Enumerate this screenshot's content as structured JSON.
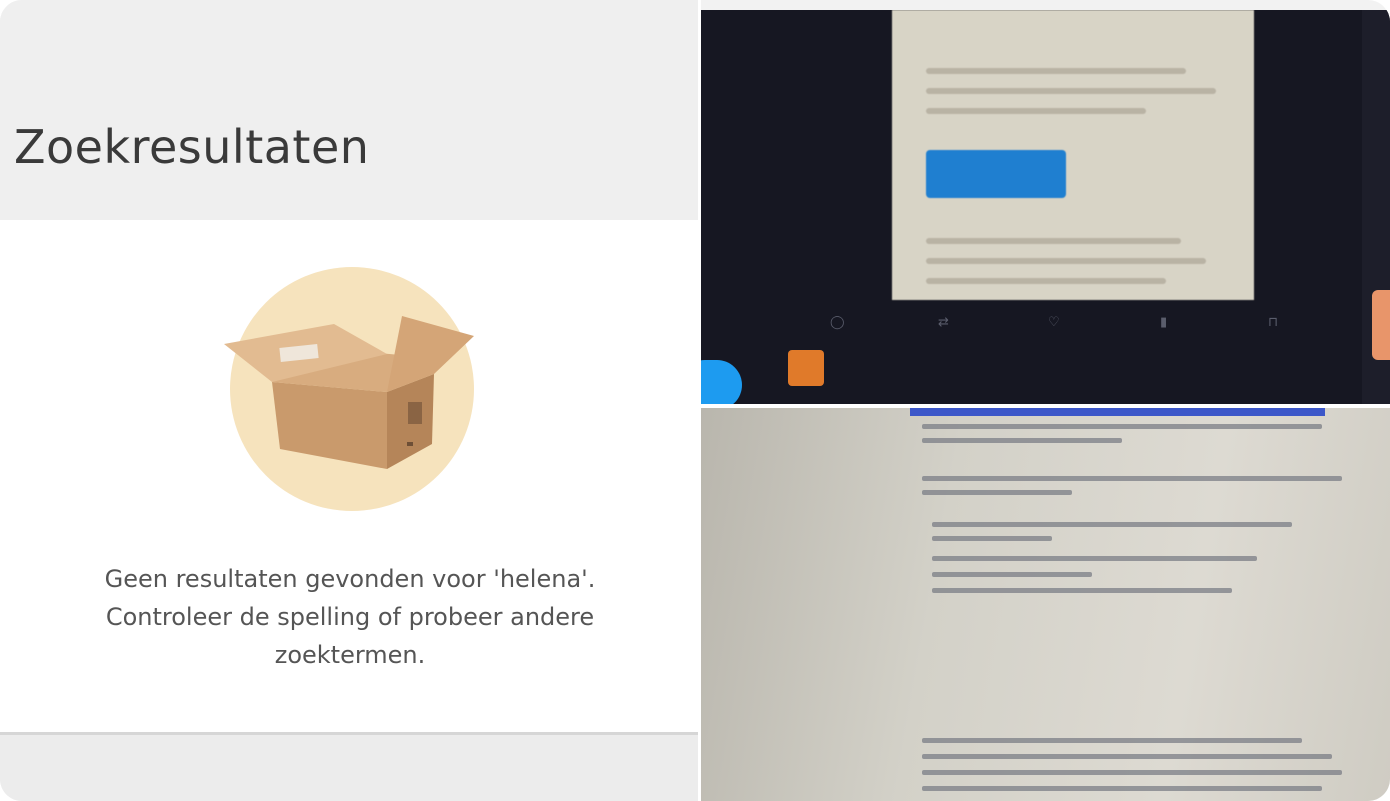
{
  "search": {
    "title": "Zoekresultaten",
    "empty_line1": "Geen resultaten gevonden voor 'helena'.",
    "empty_line2": "Controleer de spelling of probeer andere",
    "empty_line3": "zoektermen."
  },
  "colors": {
    "illustration_circle": "#f6e3bd",
    "box_main": "#c99a6c",
    "box_side": "#b58559",
    "tweet_button": "#1f7fd0"
  },
  "icons": {
    "empty_state": "open-cardboard-box-icon"
  }
}
